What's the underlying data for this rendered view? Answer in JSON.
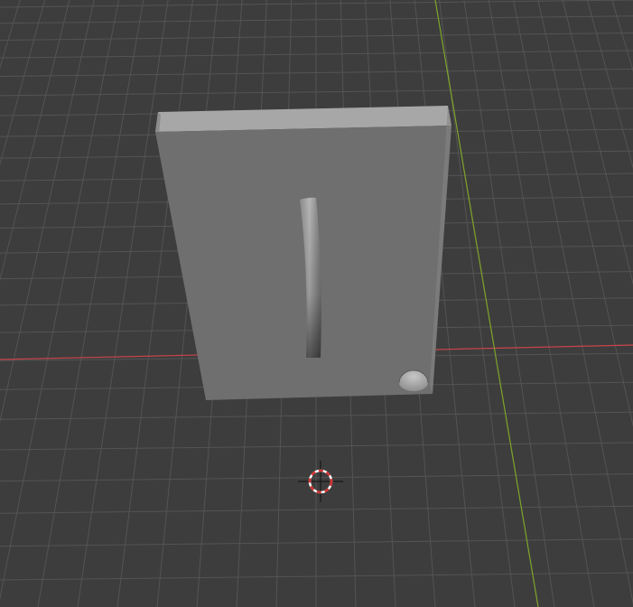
{
  "viewport": {
    "background_color": "#3d3d3d",
    "grid_line_color": "#545454",
    "x_axis_color": "#c8444a",
    "y_axis_color": "#7fa52b"
  },
  "object": {
    "type": "rectangular-plate",
    "front_face_color": "#6e6f6e",
    "top_face_color": "#a6a7a6",
    "side_face_color": "#8b8c8b",
    "features": [
      "curved-slot",
      "small-round-notch"
    ]
  },
  "cursor_3d": {
    "icon": "3d-cursor-icon",
    "ring_colors": [
      "#d43030",
      "#ffffff"
    ],
    "crosshair_color": "#111111"
  }
}
